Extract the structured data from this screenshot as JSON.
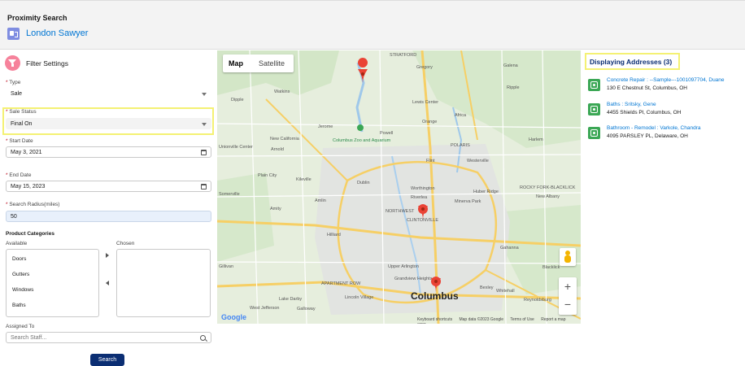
{
  "header": {
    "title": "Proximity Search",
    "record_name": "London Sawyer"
  },
  "filters": {
    "title": "Filter Settings",
    "type": {
      "label": "Type",
      "value": "Sale"
    },
    "sale_status": {
      "label": "Sale Status",
      "value": "Final On"
    },
    "start_date": {
      "label": "Start Date",
      "value": "May 3, 2021"
    },
    "end_date": {
      "label": "End Date",
      "value": "May 15, 2023"
    },
    "search_radius": {
      "label": "Search Radius(miles)",
      "value": "50"
    },
    "product_categories": {
      "label": "Product Categories",
      "available_label": "Available",
      "chosen_label": "Chosen",
      "available": [
        "Doors",
        "Gutters",
        "Windows",
        "Baths"
      ]
    },
    "assigned_to": {
      "label": "Assigned To",
      "placeholder": "Search Staff..."
    },
    "search_button": "Search"
  },
  "map": {
    "map_tab": "Map",
    "satellite_tab": "Satellite",
    "zoom_in": "+",
    "zoom_out": "−",
    "logo": "Google",
    "attribution": {
      "shortcuts": "Keyboard shortcuts",
      "data": "Map data ©2023 Google",
      "terms": "Terms of Use",
      "report": "Report a map error"
    },
    "city_label": "Columbus",
    "place_labels": {
      "stratford": "STRATFORD",
      "gregory": "Gregory",
      "galena": "Galena",
      "ripple": "Ripple",
      "watkins": "Watkins",
      "lewis_center": "Lewis Center",
      "jerome": "Jerome",
      "powell": "Powell",
      "orange": "Orange",
      "africa": "Africa",
      "new_california": "New California",
      "zoo": "Columbus Zoo and Aquarium",
      "polaris": "POLARIS",
      "harlem": "Harlem",
      "arnold": "Arnold",
      "unionville": "Unionville Center",
      "flint": "Flint",
      "westerville": "Westerville",
      "plain_city": "Plain City",
      "kileville": "Kileville",
      "dublin": "Dublin",
      "worthington": "Worthington",
      "huber_ridge": "Huber Ridge",
      "rocky_fork": "ROCKY FORK-BLACKLICK",
      "amlin": "Amlin",
      "riverlea": "Riverlea",
      "minerva_park": "Minerva Park",
      "new_albany": "New Albany",
      "amity": "Amity",
      "northwest": "NORTHWEST",
      "clintonville": "CLINTONVILLE",
      "hilliard": "Hilliard",
      "gahanna": "Gahanna",
      "upper_arlington": "Upper Arlington",
      "grandview": "Grandview Heights",
      "apartment_row": "APARTMENT ROW",
      "bexley": "Bexley",
      "whitehall": "Whitehall",
      "blacklick": "Blacklick",
      "lake_darby": "Lake Darby",
      "lincoln_village": "Lincoln Village",
      "reynoldsburg": "Reynoldsburg",
      "west_jefferson": "West Jefferson",
      "galloway": "Galloway",
      "dipple": "Dipple",
      "somerville": "Somerville",
      "gillivan": "Gillivan"
    }
  },
  "results": {
    "title": "Displaying Addresses (3)",
    "items": [
      {
        "name": "Concrete Repair : --Sample---1001097704, Duane",
        "address": "130 E Chestnut St, Columbus, OH"
      },
      {
        "name": "Baths : Sritsky, Gene",
        "address": "4455 Shields Pl, Columbus, OH"
      },
      {
        "name": "Bathroom - Remodel : Varkole, Chandra",
        "address": "4095 PARSLEY PL, Delaware, OH"
      }
    ]
  },
  "colors": {
    "accent": "#0176d3",
    "button": "#0b2e73",
    "highlight": "#f4f173",
    "marker": "#ea4335"
  }
}
